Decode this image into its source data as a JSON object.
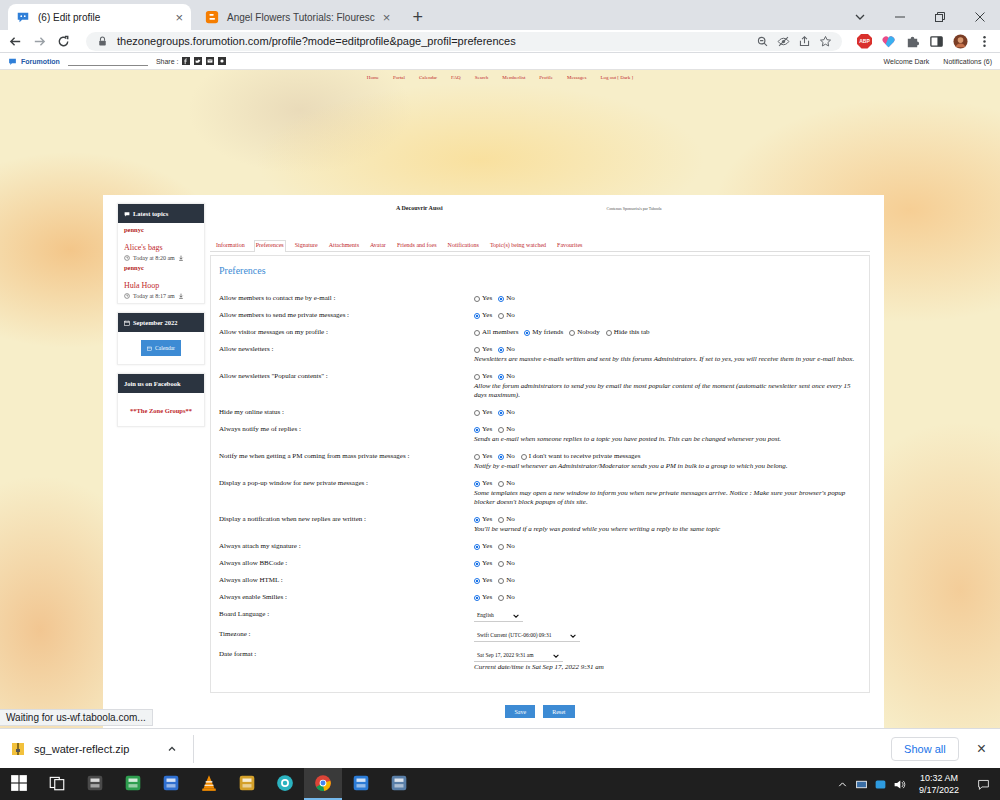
{
  "browser": {
    "tabs": [
      {
        "title": "(6) Edit profile",
        "kind": "forumotion",
        "selected": true
      },
      {
        "title": "Angel Flowers Tutorials: Flouresc",
        "kind": "blogger",
        "selected": false
      }
    ],
    "tab_close": "×",
    "new_tab": "+",
    "url": "thezonegroups.forumotion.com/profile?mode=editprofile&page_profil=preferences",
    "extension_badge": "ABP",
    "status": "Waiting for us-wf.taboola.com..."
  },
  "forumotion_bar": {
    "brand": "Forumotion",
    "share_label": "Share :",
    "welcome": "Welcome Dark",
    "notifications": "Notifications (6)"
  },
  "forum_nav": [
    "Home",
    "Portal",
    "Calendar",
    "FAQ",
    "Search",
    "Memberlist",
    "Profile",
    "Messages",
    "Log out [ Dark ]"
  ],
  "sponsored": {
    "title": "A Decouvrir Aussi",
    "credit": "Contenus Sponsorisés par Taboola"
  },
  "sidebar": {
    "latest_topics": {
      "title": "Latest topics",
      "lines": [
        {
          "kind": "author",
          "text": "pennyc"
        },
        {
          "kind": "topic",
          "text": "Alice's bags"
        },
        {
          "kind": "time",
          "text": "Today at 8:20 am"
        },
        {
          "kind": "author",
          "text": "pennyc"
        },
        {
          "kind": "topic",
          "text": "Hula Hoop"
        },
        {
          "kind": "time",
          "text": "Today at 8:17 am"
        }
      ]
    },
    "calendar": {
      "title": "September 2022",
      "button": "Calendar"
    },
    "facebook": {
      "title": "Join us on Facebook",
      "link": "**The Zone Groups**"
    }
  },
  "profile_tabs": [
    {
      "label": "Information",
      "selected": false
    },
    {
      "label": "Preferences",
      "selected": true
    },
    {
      "label": "Signature",
      "selected": false
    },
    {
      "label": "Attachments",
      "selected": false
    },
    {
      "label": "Avatar",
      "selected": false
    },
    {
      "label": "Friends and foes",
      "selected": false
    },
    {
      "label": "Notifications",
      "selected": false
    },
    {
      "label": "Topic(s) being watched",
      "selected": false
    },
    {
      "label": "Favourites",
      "selected": false
    }
  ],
  "preferences": {
    "title": "Preferences",
    "rows": [
      {
        "label": "Allow members to contact me by e-mail :",
        "kind": "radio",
        "options": [
          {
            "label": "Yes",
            "selected": false
          },
          {
            "label": "No",
            "selected": true
          }
        ]
      },
      {
        "label": "Allow members to send me private messages :",
        "kind": "radio",
        "options": [
          {
            "label": "Yes",
            "selected": true
          },
          {
            "label": "No",
            "selected": false
          }
        ]
      },
      {
        "label": "Allow visitor messages on my profile :",
        "kind": "radio",
        "options": [
          {
            "label": "All members",
            "selected": false
          },
          {
            "label": "My friends",
            "selected": true
          },
          {
            "label": "Nobody",
            "selected": false
          },
          {
            "label": "Hide this tab",
            "selected": false
          }
        ]
      },
      {
        "label": "Allow newsletters :",
        "kind": "radio",
        "options": [
          {
            "label": "Yes",
            "selected": false
          },
          {
            "label": "No",
            "selected": true
          }
        ],
        "description": "Newsletters are massive e-mails written and sent by this forums Administrators. If set to yes, you will receive them in your e-mail inbox."
      },
      {
        "label": "Allow newsletters \"Popular contents\" :",
        "kind": "radio",
        "options": [
          {
            "label": "Yes",
            "selected": false
          },
          {
            "label": "No",
            "selected": true
          }
        ],
        "description": "Allow the forum administrators to send you by email the most popular content of the moment (automatic newsletter sent once every 15 days maximum)."
      },
      {
        "label": "Hide my online status :",
        "kind": "radio",
        "options": [
          {
            "label": "Yes",
            "selected": false
          },
          {
            "label": "No",
            "selected": true
          }
        ]
      },
      {
        "label": "Always notify me of replies :",
        "kind": "radio",
        "options": [
          {
            "label": "Yes",
            "selected": true
          },
          {
            "label": "No",
            "selected": false
          }
        ],
        "description": "Sends an e-mail when someone replies to a topic you have posted in. This can be changed whenever you post."
      },
      {
        "label": "Notify me when getting a PM coming from mass private messages :",
        "kind": "radio",
        "options": [
          {
            "label": "Yes",
            "selected": false
          },
          {
            "label": "No",
            "selected": true
          },
          {
            "label": "I don't want to receive private messages",
            "selected": false
          }
        ],
        "description": "Notify by e-mail whenever an Administrator/Moderator sends you a PM in bulk to a group to which you belong."
      },
      {
        "label": "Display a pop-up window for new private messages :",
        "kind": "radio",
        "options": [
          {
            "label": "Yes",
            "selected": true
          },
          {
            "label": "No",
            "selected": false
          }
        ],
        "description": "Some templates may open a new window to inform you when new private messages arrive. Notice : Make sure your browser's popup blocker doesn't block popups of this site."
      },
      {
        "label": "Display a notification when new replies are written :",
        "kind": "radio",
        "options": [
          {
            "label": "Yes",
            "selected": true
          },
          {
            "label": "No",
            "selected": false
          }
        ],
        "description": "You'll be warned if a reply was posted while you where writing a reply to the same topic"
      },
      {
        "label": "Always attach my signature :",
        "kind": "radio",
        "options": [
          {
            "label": "Yes",
            "selected": true
          },
          {
            "label": "No",
            "selected": false
          }
        ]
      },
      {
        "label": "Always allow BBCode :",
        "kind": "radio",
        "options": [
          {
            "label": "Yes",
            "selected": true
          },
          {
            "label": "No",
            "selected": false
          }
        ]
      },
      {
        "label": "Always allow HTML :",
        "kind": "radio",
        "options": [
          {
            "label": "Yes",
            "selected": true
          },
          {
            "label": "No",
            "selected": false
          }
        ]
      },
      {
        "label": "Always enable Smilies :",
        "kind": "radio",
        "options": [
          {
            "label": "Yes",
            "selected": true
          },
          {
            "label": "No",
            "selected": false
          }
        ]
      },
      {
        "label": "Board Language :",
        "kind": "select",
        "value": "English"
      },
      {
        "label": "Timezone :",
        "kind": "select",
        "value": "Swift Current (UTC-06:00) 09:31"
      },
      {
        "label": "Date format :",
        "kind": "select",
        "value": "Sat Sep 17, 2022 9:31 am",
        "description": "Current date/time is Sat Sep 17, 2022 9:31 am"
      }
    ]
  },
  "buttons": [
    "Save",
    "Reset"
  ],
  "downloads": {
    "file": "sg_water-reflect.zip",
    "show_all": "Show all",
    "close": "×"
  },
  "taskbar": {
    "apps": [
      {
        "kind": "windows",
        "active": false
      },
      {
        "kind": "taskview",
        "active": false
      },
      {
        "kind": "calculator",
        "active": false
      },
      {
        "kind": "feather",
        "active": false
      },
      {
        "kind": "disk",
        "active": false
      },
      {
        "kind": "vlc",
        "active": false
      },
      {
        "kind": "paint",
        "active": false
      },
      {
        "kind": "camera",
        "active": false
      },
      {
        "kind": "chrome",
        "active": true
      },
      {
        "kind": "writer",
        "active": false
      },
      {
        "kind": "viewer",
        "active": false
      }
    ],
    "time": "10:32 AM",
    "date": "9/17/2022"
  }
}
